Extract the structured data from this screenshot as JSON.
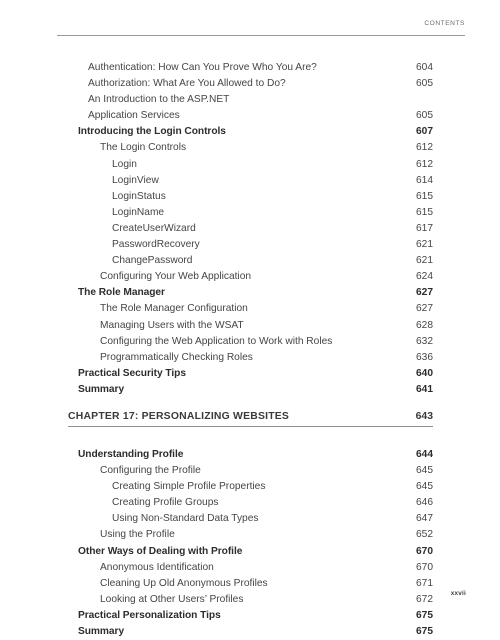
{
  "running_head": {
    "label": "CONTENTS"
  },
  "folio": {
    "page_number": "xxvii"
  },
  "colors": {
    "text": "#45454a",
    "heading": "#2d2d30",
    "rule": "#9a9a9d",
    "running_head": "#6e6e72",
    "background": "#ffffff"
  },
  "toc": {
    "entries": [
      {
        "level": 1,
        "title": "Authentication: How Can You Prove Who You Are?",
        "page": "604"
      },
      {
        "level": 1,
        "title": "Authorization: What Are You Allowed to Do?",
        "page": "605"
      },
      {
        "level": 1,
        "title": "An Introduction to the ASP.NET",
        "page": "",
        "continues": true
      },
      {
        "level": 1,
        "title": "Application Services",
        "page": "605"
      },
      {
        "level": "h",
        "title": "Introducing the Login Controls",
        "page": "607"
      },
      {
        "level": 2,
        "title": "The Login Controls",
        "page": "612"
      },
      {
        "level": 3,
        "title": "Login",
        "page": "612"
      },
      {
        "level": 3,
        "title": "LoginView",
        "page": "614"
      },
      {
        "level": 3,
        "title": "LoginStatus",
        "page": "615"
      },
      {
        "level": 3,
        "title": "LoginName",
        "page": "615"
      },
      {
        "level": 3,
        "title": "CreateUserWizard",
        "page": "617"
      },
      {
        "level": 3,
        "title": "PasswordRecovery",
        "page": "621"
      },
      {
        "level": 3,
        "title": "ChangePassword",
        "page": "621"
      },
      {
        "level": 2,
        "title": "Configuring Your Web Application",
        "page": "624"
      },
      {
        "level": "h",
        "title": "The Role Manager",
        "page": "627"
      },
      {
        "level": 2,
        "title": "The Role Manager Configuration",
        "page": "627"
      },
      {
        "level": 2,
        "title": "Managing Users with the WSAT",
        "page": "628"
      },
      {
        "level": 2,
        "title": "Configuring the Web Application to Work with Roles",
        "page": "632"
      },
      {
        "level": 2,
        "title": "Programmatically Checking Roles",
        "page": "636"
      },
      {
        "level": "h",
        "title": "Practical Security Tips",
        "page": "640"
      },
      {
        "level": "h",
        "title": "Summary",
        "page": "641"
      }
    ]
  },
  "chapter": {
    "title": "CHAPTER 17: PERSONALIZING WEBSITES",
    "page": "643"
  },
  "toc_after": {
    "entries": [
      {
        "level": "h",
        "title": "Understanding Profile",
        "page": "644"
      },
      {
        "level": 2,
        "title": "Configuring the Profile",
        "page": "645"
      },
      {
        "level": 3,
        "title": "Creating Simple Profile Properties",
        "page": "645"
      },
      {
        "level": 3,
        "title": "Creating Profile Groups",
        "page": "646"
      },
      {
        "level": 3,
        "title": "Using Non-Standard Data Types",
        "page": "647"
      },
      {
        "level": 2,
        "title": "Using the Profile",
        "page": "652"
      },
      {
        "level": "h",
        "title": "Other Ways of Dealing with Profile",
        "page": "670"
      },
      {
        "level": 2,
        "title": "Anonymous Identification",
        "page": "670"
      },
      {
        "level": 2,
        "title": "Cleaning Up Old Anonymous Profiles",
        "page": "671"
      },
      {
        "level": 2,
        "title": "Looking at Other Users’ Profiles",
        "page": "672"
      },
      {
        "level": "h",
        "title": "Practical Personalization Tips",
        "page": "675"
      },
      {
        "level": "h",
        "title": "Summary",
        "page": "675"
      }
    ]
  }
}
